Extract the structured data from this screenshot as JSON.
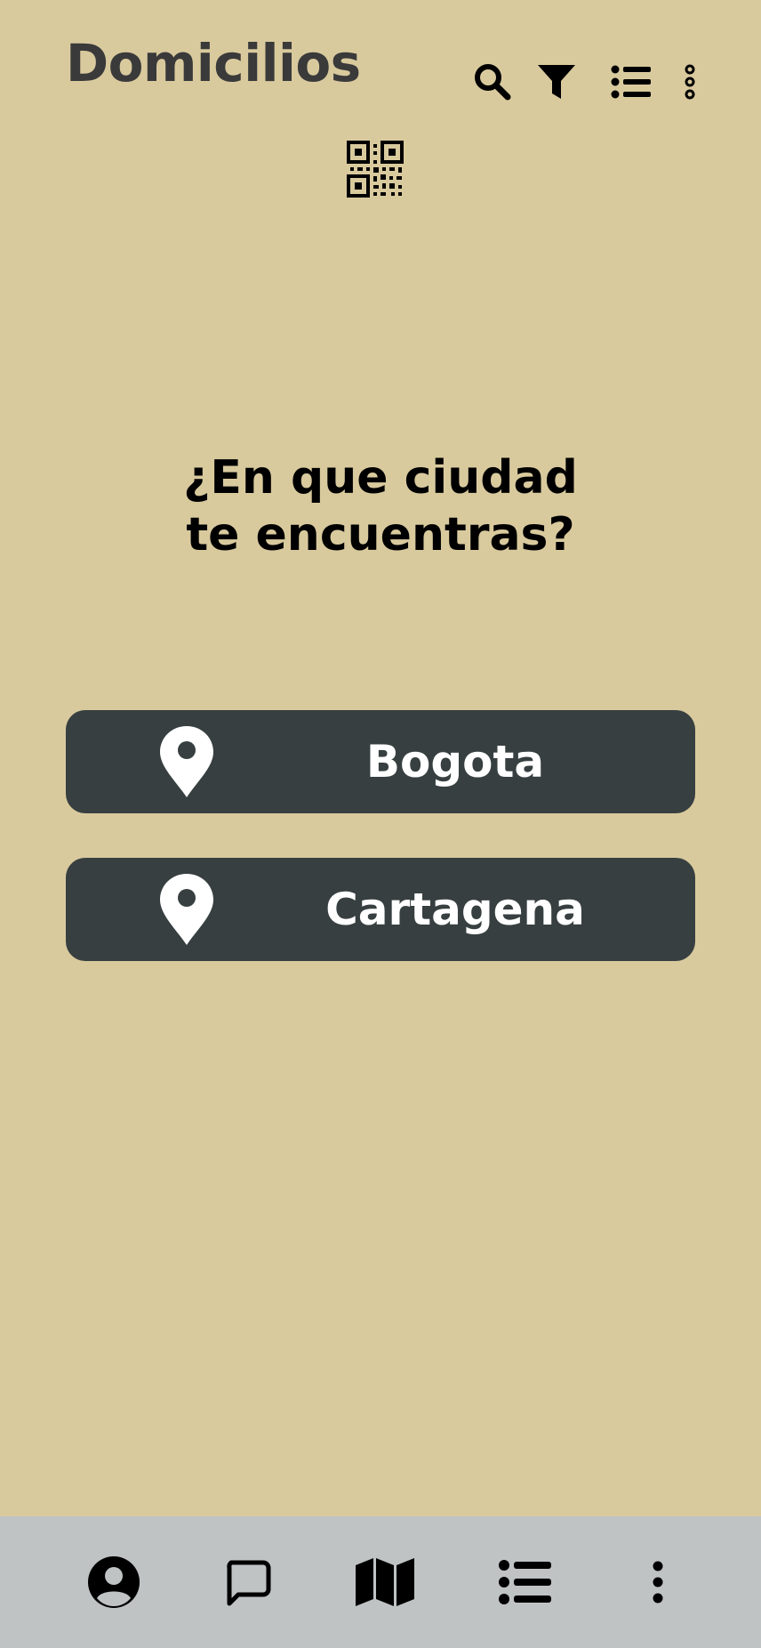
{
  "header": {
    "title": "Domicilios",
    "icons": [
      "search-icon",
      "filter-icon",
      "list-icon",
      "more-vertical-icon"
    ]
  },
  "qr": {
    "icon": "qr-code-icon"
  },
  "main": {
    "question_line1": "¿En que ciudad",
    "question_line2": "te encuentras?"
  },
  "cities": [
    {
      "label": "Bogota",
      "icon": "map-pin-icon"
    },
    {
      "label": "Cartagena",
      "icon": "map-pin-icon"
    }
  ],
  "bottom_nav": {
    "items": [
      "profile-icon",
      "chat-icon",
      "map-icon",
      "list-icon",
      "more-vertical-icon"
    ]
  },
  "colors": {
    "background": "#D9CA9E",
    "button": "#373F40",
    "button_text": "#FFFFFF",
    "bottom_bar": "#BFC3C4",
    "title": "#3A3A3A"
  }
}
